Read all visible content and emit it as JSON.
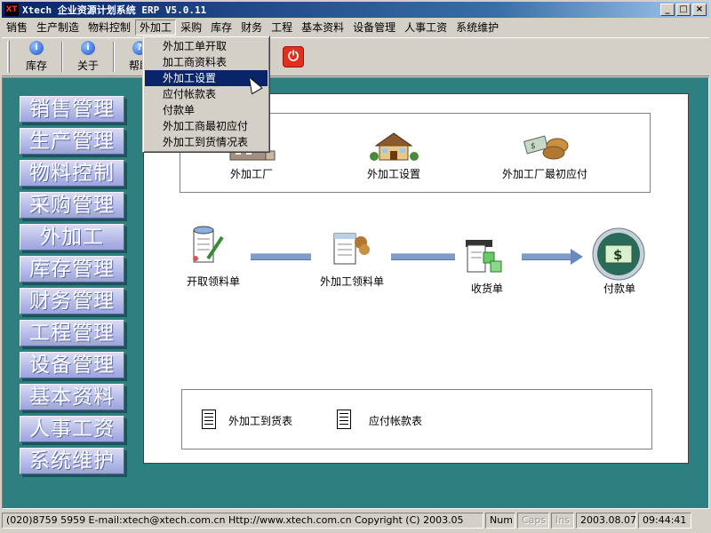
{
  "window": {
    "title": "Xtech 企业资源计划系统 ERP V5.0.11",
    "icon_text": "XT",
    "buttons": [
      "_",
      "□",
      "×"
    ]
  },
  "menubar": {
    "items": [
      "销售",
      "生产制造",
      "物料控制",
      "外加工",
      "采购",
      "库存",
      "财务",
      "工程",
      "基本资料",
      "设备管理",
      "人事工资",
      "系统维护"
    ],
    "active_index": 3
  },
  "toolbar": {
    "buttons": [
      {
        "label": "库存",
        "icon": "info-icon"
      },
      {
        "label": "关于",
        "icon": "info-icon"
      },
      {
        "label": "帮助",
        "icon": "help-icon"
      }
    ],
    "power_icon": "power-icon"
  },
  "dropdown": {
    "items": [
      "外加工单开取",
      "加工商资料表",
      "外加工设置",
      "应付帐款表",
      "付款单",
      "外加工商最初应付",
      "外加工到货情况表"
    ],
    "selected_index": 2
  },
  "sidebar": {
    "items": [
      "销售管理",
      "生产管理",
      "物料控制",
      "采购管理",
      "外加工",
      "库存管理",
      "财务管理",
      "工程管理",
      "设备管理",
      "基本资料",
      "人事工资",
      "系统维护"
    ]
  },
  "panel": {
    "top_icons": [
      {
        "label": "外加工厂",
        "icon": "factory-icon"
      },
      {
        "label": "外加工设置",
        "icon": "house-icon"
      },
      {
        "label": "外加工厂最初应付",
        "icon": "payment-icon"
      }
    ],
    "flow": [
      {
        "label": "开取领料单",
        "icon": "scroll-pen-icon"
      },
      {
        "label": "外加工领料单",
        "icon": "document-icon"
      },
      {
        "label": "收货单",
        "icon": "receipt-icon"
      },
      {
        "label": "付款单",
        "icon": "dollar-icon",
        "symbol": "$"
      }
    ],
    "reports": [
      {
        "label": "外加工到货表",
        "icon": "report-icon"
      },
      {
        "label": "应付帐款表",
        "icon": "report-icon"
      }
    ]
  },
  "statusbar": {
    "contact": "(020)8759 5959  E-mail:xtech@xtech.com.cn  Http://www.xtech.com.cn Copyright (C) 2003.05",
    "num": "Num",
    "caps": "Caps",
    "ins": "Ins",
    "date": "2003.08.07",
    "time": "09:44:41"
  },
  "colors": {
    "titlebar": "#0a246a",
    "desktop": "#2e7f7f",
    "selection": "#0a246a",
    "sidebar_button": "#9aa3dd"
  }
}
